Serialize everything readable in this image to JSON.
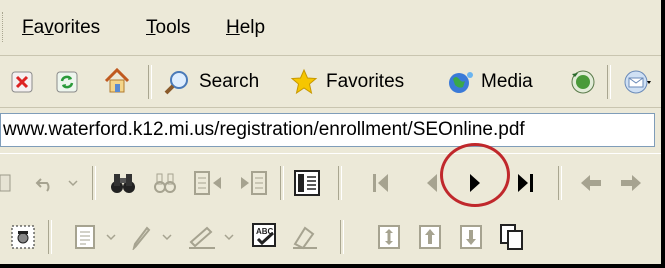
{
  "menu": {
    "favorites": "Favorites",
    "tools": "Tools",
    "help": "Help"
  },
  "toolbar": {
    "search_label": "Search",
    "favorites_label": "Favorites",
    "media_label": "Media"
  },
  "address": {
    "value": "www.waterford.k12.mi.us/registration/enrollment/SEOnline.pdf"
  },
  "icons": {
    "stop": "stop-icon",
    "refresh": "refresh-icon",
    "home": "home-icon",
    "search": "search-icon",
    "favorites": "star-icon",
    "media": "media-icon",
    "history": "history-icon",
    "mail": "mail-icon",
    "undo": "undo-icon",
    "find": "binoculars-icon",
    "first": "first-page-icon",
    "prev": "previous-page-icon",
    "next": "next-page-icon",
    "last": "last-page-icon",
    "back": "back-arrow-icon",
    "forward": "forward-arrow-icon"
  },
  "colors": {
    "highlight_circle": "#c0282c",
    "toolbar_bg": "#ece9d8"
  }
}
